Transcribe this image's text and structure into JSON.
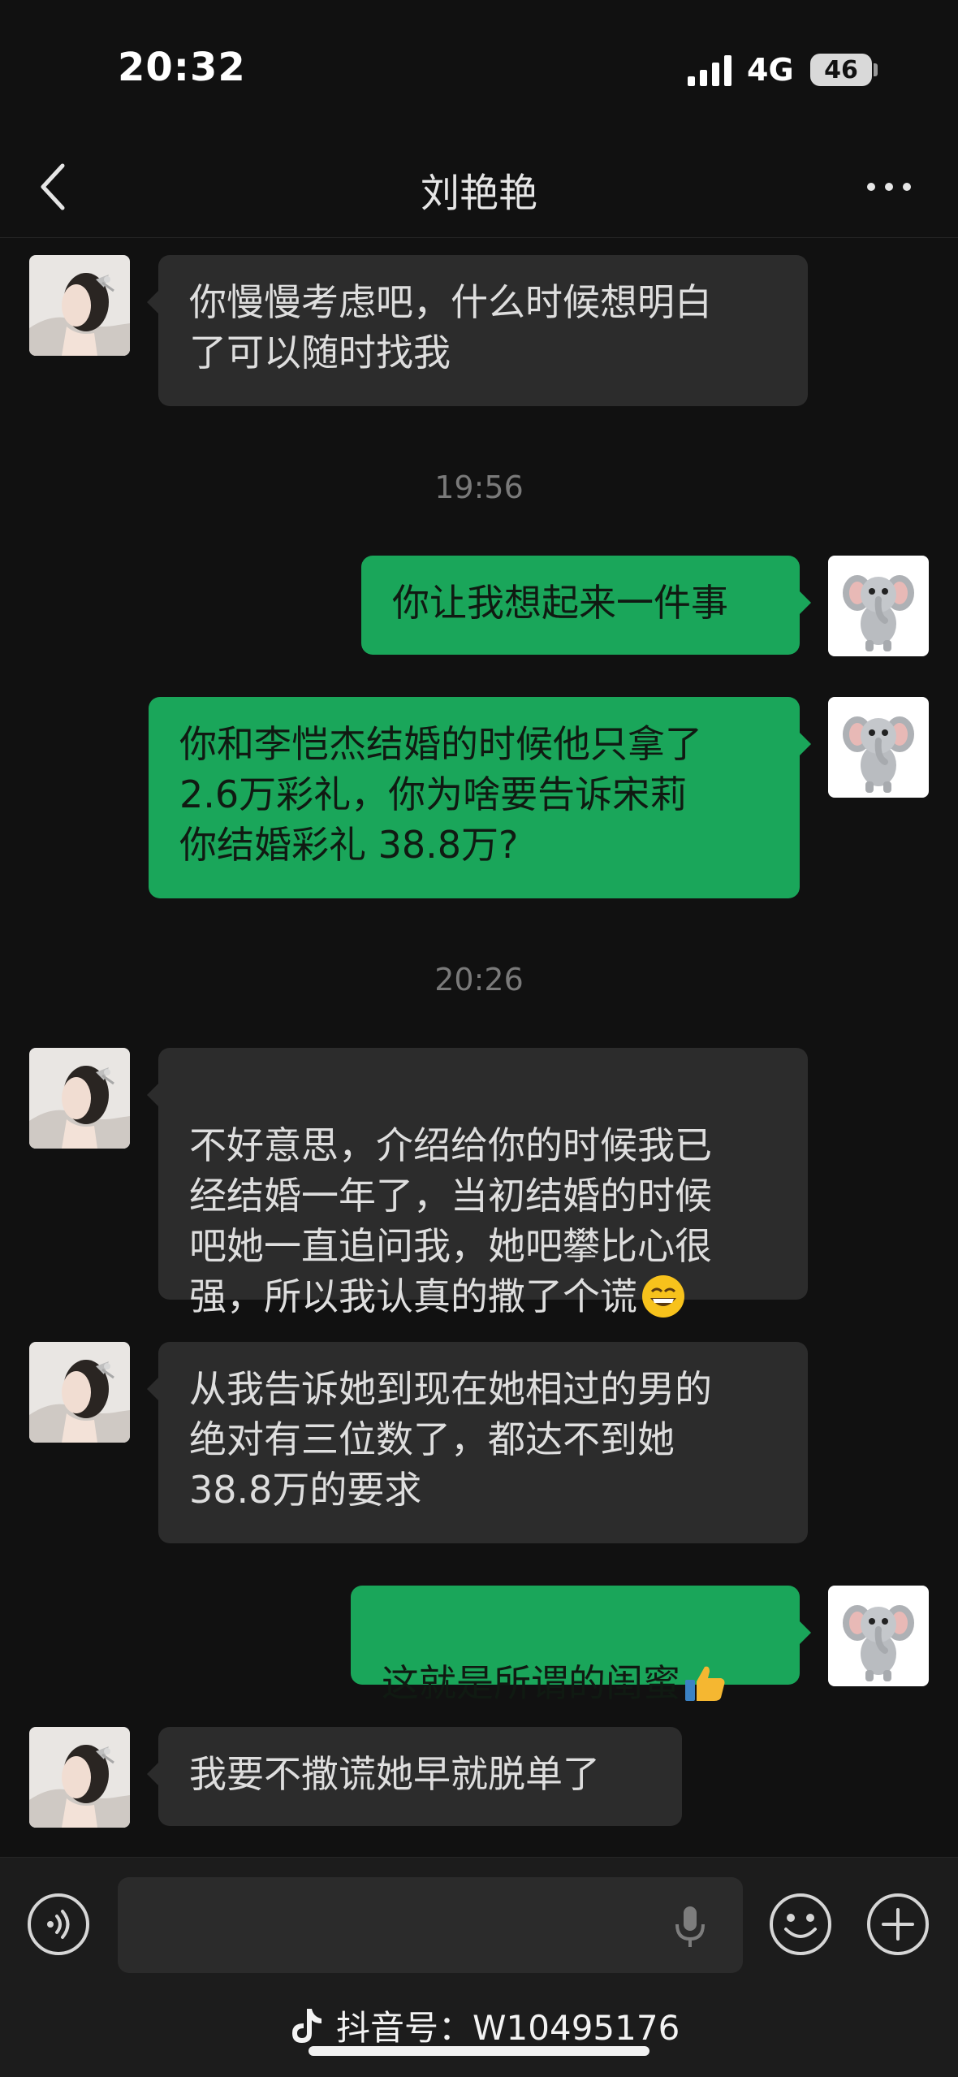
{
  "status_bar": {
    "time": "20:32",
    "network": "4G",
    "battery": "46"
  },
  "nav": {
    "title": "刘艳艳"
  },
  "messages": [
    {
      "side": "in",
      "text": "你慢慢考虑吧，什么时候想明白\n了可以随时找我"
    },
    {
      "side": "out",
      "text": "你让我想起来一件事"
    },
    {
      "side": "out",
      "text": "你和李恺杰结婚的时候他只拿了\n2.6万彩礼，你为啥要告诉宋莉\n你结婚彩礼 38.8万?"
    },
    {
      "side": "in",
      "text": "不好意思，介绍给你的时候我已\n经结婚一年了，当初结婚的时候\n吧她一直追问我，她吧攀比心很\n强，所以我认真的撒了个谎"
    },
    {
      "side": "in",
      "text": "从我告诉她到现在她相过的男的\n绝对有三位数了，都达不到她\n38.8万的要求"
    },
    {
      "side": "out",
      "text": "这就是所谓的闺蜜"
    },
    {
      "side": "in",
      "text": "我要不撒谎她早就脱单了"
    }
  ],
  "timestamps": [
    "19:56",
    "20:26"
  ],
  "emojis": {
    "grin": "grinning-face-emoji",
    "thumbs": "thumbs-up-emoji"
  },
  "input_bar": {
    "voice_icon": "voice-icon",
    "emoji_icon": "emoji-icon",
    "plus_icon": "plus-icon"
  },
  "watermark": {
    "text": "抖音号：W10495176"
  },
  "colors": {
    "background": "#111111",
    "incoming_bubble": "#2c2c2c",
    "outgoing_bubble": "#1aa65a"
  }
}
